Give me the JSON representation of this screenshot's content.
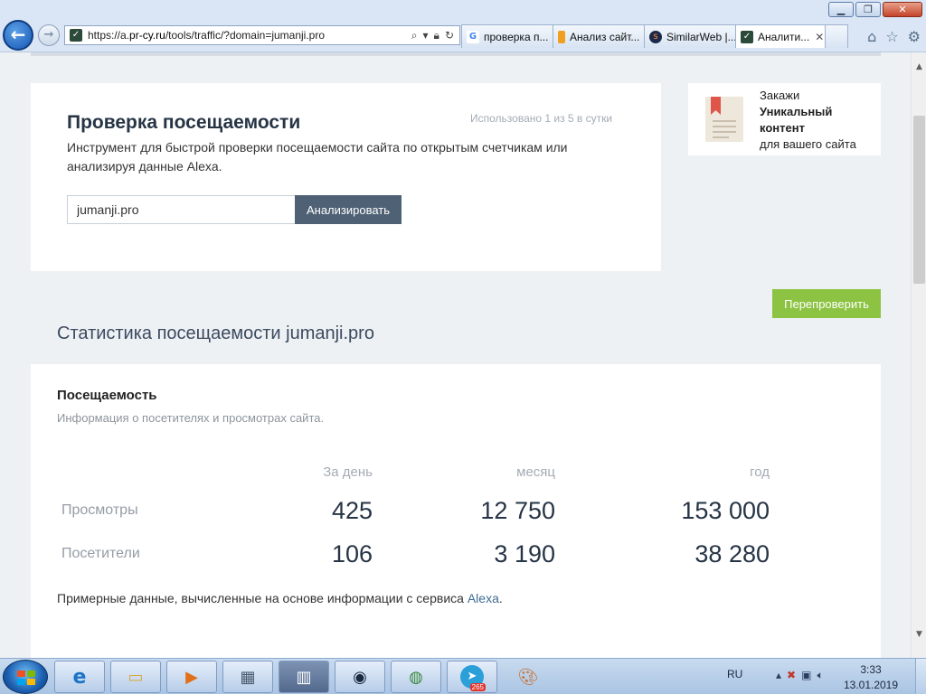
{
  "browser": {
    "url_prefix": "https://a.",
    "url_domain": "pr-cy.ru",
    "url_path": "/tools/traffic/?domain=jumanji.pro",
    "window_buttons": [
      "▁",
      "❐",
      "✕"
    ],
    "tabs": [
      {
        "label": "проверка п...",
        "icon": "google-icon",
        "icon_color": "#4285f4",
        "active": false
      },
      {
        "label": "Анализ сайт...",
        "icon": "bookmark-icon",
        "icon_color": "#f0a020",
        "active": false
      },
      {
        "label": "SimilarWeb |...",
        "icon": "similarweb-icon",
        "icon_color": "#1b2a4a",
        "active": false
      },
      {
        "label": "Аналити...",
        "icon": "check-icon",
        "icon_color": "#2c4a3a",
        "active": true
      }
    ]
  },
  "tool": {
    "title": "Проверка посещаемости",
    "usage": "Использовано 1 из 5 в сутки",
    "description": "Инструмент для быстрой проверки посещаемости сайта по открытым счетчикам или анализируя данные Alexa.",
    "input_value": "jumanji.pro",
    "analyze_label": "Анализировать"
  },
  "ad": {
    "line1": "Закажи",
    "line2": "Уникальный",
    "line3": "контент",
    "line4": "для вашего сайта"
  },
  "recheck_label": "Перепроверить",
  "stats_title": "Статистика посещаемости jumanji.pro",
  "traffic": {
    "heading": "Посещаемость",
    "subheading": "Информация о посетителях и просмотрах сайта.",
    "columns": [
      "За день",
      "месяц",
      "год"
    ],
    "rows": [
      {
        "label": "Просмотры",
        "values": [
          "425",
          "12 750",
          "153 000"
        ]
      },
      {
        "label": "Посетители",
        "values": [
          "106",
          "3 190",
          "38 280"
        ]
      }
    ],
    "note_prefix": "Примерные данные, вычисленные на основе информации с сервиса ",
    "note_link": "Alexa",
    "note_suffix": "."
  },
  "taskbar": {
    "language": "RU",
    "time": "3:33",
    "date": "13.01.2019",
    "telegram_badge": "265",
    "apps": [
      "internet-explorer-icon",
      "file-explorer-icon",
      "media-player-icon",
      "calculator-icon",
      "app-icon",
      "lock-app-icon",
      "globe-icon",
      "telegram-icon",
      "paint-icon"
    ]
  },
  "colors": {
    "accent_dark": "#4f6275",
    "accent_green": "#8cc342",
    "link": "#3f6b94"
  }
}
